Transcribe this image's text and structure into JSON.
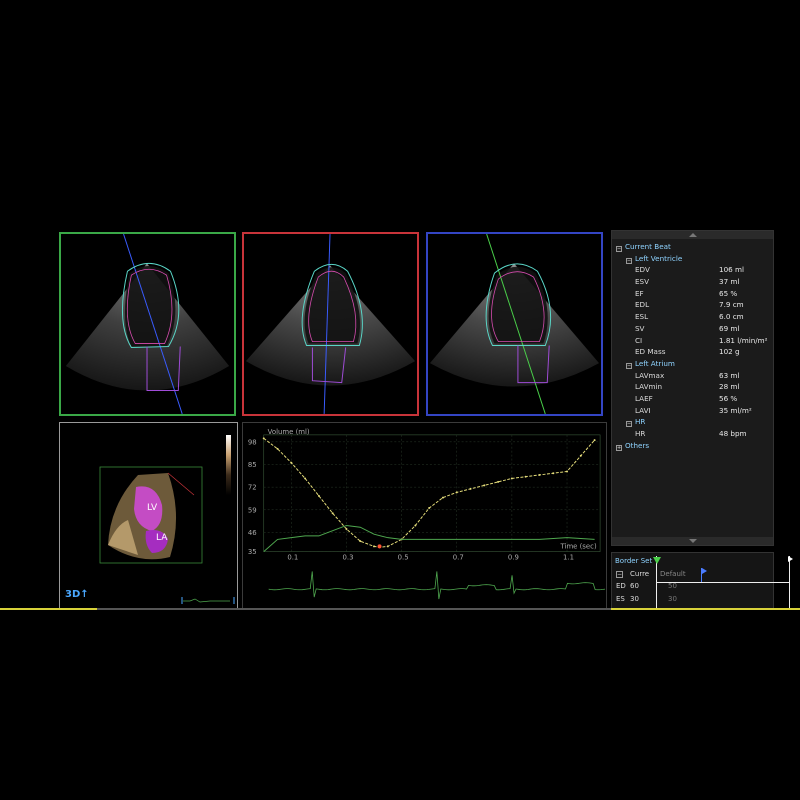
{
  "views": [
    {
      "id": "view-4ch",
      "border": "#3aa847"
    },
    {
      "id": "view-2ch",
      "border": "#c8343a"
    },
    {
      "id": "view-3ch",
      "border": "#3445c4"
    }
  ],
  "render3d": {
    "label_lv": "LV",
    "label_la": "LA",
    "mode_label": "3D↑"
  },
  "chart_data": {
    "type": "line",
    "ylabel": "Volume (ml)",
    "xlabel": "Time (sec)",
    "yticks": [
      35,
      46,
      59,
      72,
      85,
      98
    ],
    "xticks": [
      0.1,
      0.3,
      0.5,
      0.7,
      0.9,
      1.1
    ],
    "ylim": [
      35,
      102
    ],
    "xlim": [
      0.0,
      1.22
    ],
    "series": [
      {
        "color": "#e5dd7a",
        "x": [
          0.0,
          0.05,
          0.1,
          0.15,
          0.2,
          0.25,
          0.3,
          0.35,
          0.4,
          0.42,
          0.45,
          0.5,
          0.55,
          0.6,
          0.65,
          0.7,
          0.75,
          0.8,
          0.85,
          0.9,
          0.95,
          1.0,
          1.05,
          1.1,
          1.15,
          1.2
        ],
        "y": [
          100,
          94,
          86,
          77,
          67,
          57,
          48,
          41,
          38,
          37.5,
          38,
          42,
          50,
          60,
          66,
          69,
          71,
          73,
          75,
          77,
          78,
          79,
          80,
          81,
          90,
          99
        ]
      },
      {
        "color": "#4fa84f",
        "x": [
          0.0,
          0.05,
          0.1,
          0.15,
          0.2,
          0.25,
          0.3,
          0.35,
          0.4,
          0.45,
          0.5,
          0.55,
          0.6,
          0.7,
          0.8,
          0.9,
          1.0,
          1.1,
          1.2
        ],
        "y": [
          35,
          42,
          43,
          44,
          44,
          47,
          50,
          49,
          45,
          43,
          42,
          42,
          42,
          42,
          42,
          42,
          42,
          43,
          42
        ]
      }
    ],
    "marker": {
      "x": 0.42,
      "y": 38,
      "color": "#ff5533"
    }
  },
  "panel": {
    "current_beat": "Current Beat",
    "left_ventricle": "Left Ventricle",
    "lv_rows": [
      {
        "label": "EDV",
        "value": "106 ml"
      },
      {
        "label": "ESV",
        "value": "37 ml"
      },
      {
        "label": "EF",
        "value": "65 %"
      },
      {
        "label": "EDL",
        "value": "7.9 cm"
      },
      {
        "label": "ESL",
        "value": "6.0 cm"
      },
      {
        "label": "SV",
        "value": "69 ml"
      },
      {
        "label": "CI",
        "value": "1.81 l/min/m²"
      },
      {
        "label": "ED Mass",
        "value": "102 g"
      }
    ],
    "left_atrium": "Left Atrium",
    "la_rows": [
      {
        "label": "LAVmax",
        "value": "63 ml"
      },
      {
        "label": "LAVmin",
        "value": "28 ml"
      },
      {
        "label": "LAEF",
        "value": "56 %"
      },
      {
        "label": "LAVI",
        "value": "35 ml/m²"
      }
    ],
    "hr": "HR",
    "hr_rows": [
      {
        "label": "HR",
        "value": "48 bpm"
      }
    ],
    "others": "Others"
  },
  "border_set": {
    "title": "Border Set",
    "col_current": "Curre",
    "col_default": "Default",
    "rows": [
      {
        "label": "ED",
        "current": "60",
        "default": "50"
      },
      {
        "label": "ES",
        "current": "30",
        "default": "30"
      }
    ]
  }
}
